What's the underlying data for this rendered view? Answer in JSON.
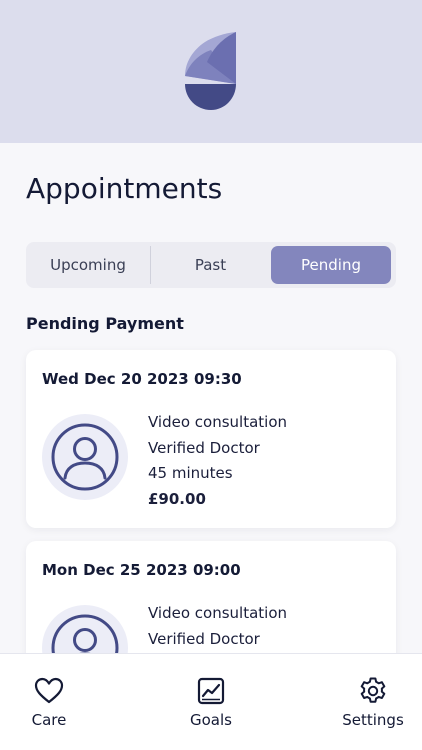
{
  "page": {
    "title": "Appointments"
  },
  "segments": [
    {
      "label": "Upcoming",
      "selected": false
    },
    {
      "label": "Past",
      "selected": false
    },
    {
      "label": "Pending",
      "selected": true
    }
  ],
  "section": {
    "heading": "Pending Payment"
  },
  "appointments": [
    {
      "date": "Wed Dec 20 2023 09:30",
      "type": "Video consultation",
      "doctor": "Verified Doctor",
      "duration": "45 minutes",
      "price": "£90.00"
    },
    {
      "date": "Mon Dec 25 2023 09:00",
      "type": "Video consultation",
      "doctor": "Verified Doctor"
    }
  ],
  "tabbar": [
    {
      "label": "Care",
      "icon": "heart-icon"
    },
    {
      "label": "Goals",
      "icon": "chart-icon"
    },
    {
      "label": "Settings",
      "icon": "gear-icon"
    }
  ],
  "colors": {
    "header_bg": "#dcdded",
    "accent": "#8386bd",
    "logo_dark": "#434a86"
  }
}
